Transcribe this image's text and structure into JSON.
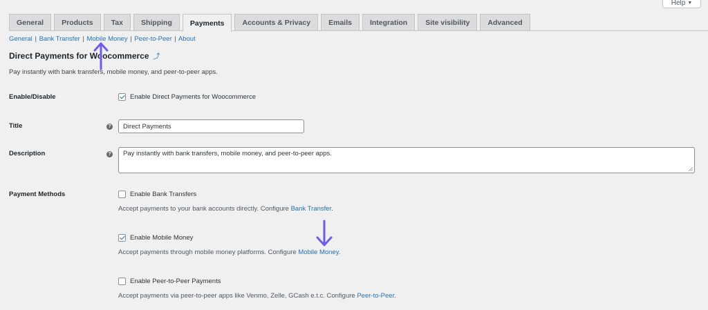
{
  "help": {
    "label": "Help",
    "caret": "▼"
  },
  "tabs": [
    {
      "label": "General"
    },
    {
      "label": "Products"
    },
    {
      "label": "Tax"
    },
    {
      "label": "Shipping"
    },
    {
      "label": "Payments",
      "active": true
    },
    {
      "label": "Accounts & Privacy"
    },
    {
      "label": "Emails"
    },
    {
      "label": "Integration"
    },
    {
      "label": "Site visibility"
    },
    {
      "label": "Advanced"
    }
  ],
  "subnav": {
    "items": [
      "General",
      "Bank Transfer",
      "Mobile Money",
      "Peer-to-Peer",
      "About"
    ],
    "separator": "|"
  },
  "page": {
    "title": "Direct Payments for Woocommerce",
    "title_icon": "up-arrow-link-icon",
    "title_icon_glyph": "⤴",
    "description": "Pay instantly with bank transfers, mobile money, and peer-to-peer apps."
  },
  "fields": {
    "enable": {
      "label": "Enable/Disable",
      "checkbox_label": "Enable Direct Payments for Woocommerce",
      "checked": true
    },
    "title": {
      "label": "Title",
      "value": "Direct Payments"
    },
    "description": {
      "label": "Description",
      "value": "Pay instantly with bank transfers, mobile money, and peer-to-peer apps."
    },
    "methods": {
      "label": "Payment Methods",
      "bank": {
        "checkbox_label": "Enable Bank Transfers",
        "checked": false,
        "note_prefix": "Accept payments to your bank accounts directly. Configure ",
        "link": "Bank Transfer",
        "note_suffix": "."
      },
      "mobile": {
        "checkbox_label": "Enable Mobile Money",
        "checked": true,
        "note_prefix": "Accept payments through mobile money platforms. Configure ",
        "link": "Mobile Money",
        "note_suffix": "."
      },
      "p2p": {
        "checkbox_label": "Enable Peer-to-Peer Payments",
        "checked": false,
        "note_prefix": "Accept payments via peer-to-peer apps like Venmo, Zelle, GCash e.t.c. Configure ",
        "link": "Peer-to-Peer",
        "note_suffix": "."
      }
    }
  },
  "help_tip_glyph": "?",
  "colors": {
    "link": "#2271b1",
    "annotation_arrow": "#6c5ce7",
    "background": "#f0f0f1"
  }
}
